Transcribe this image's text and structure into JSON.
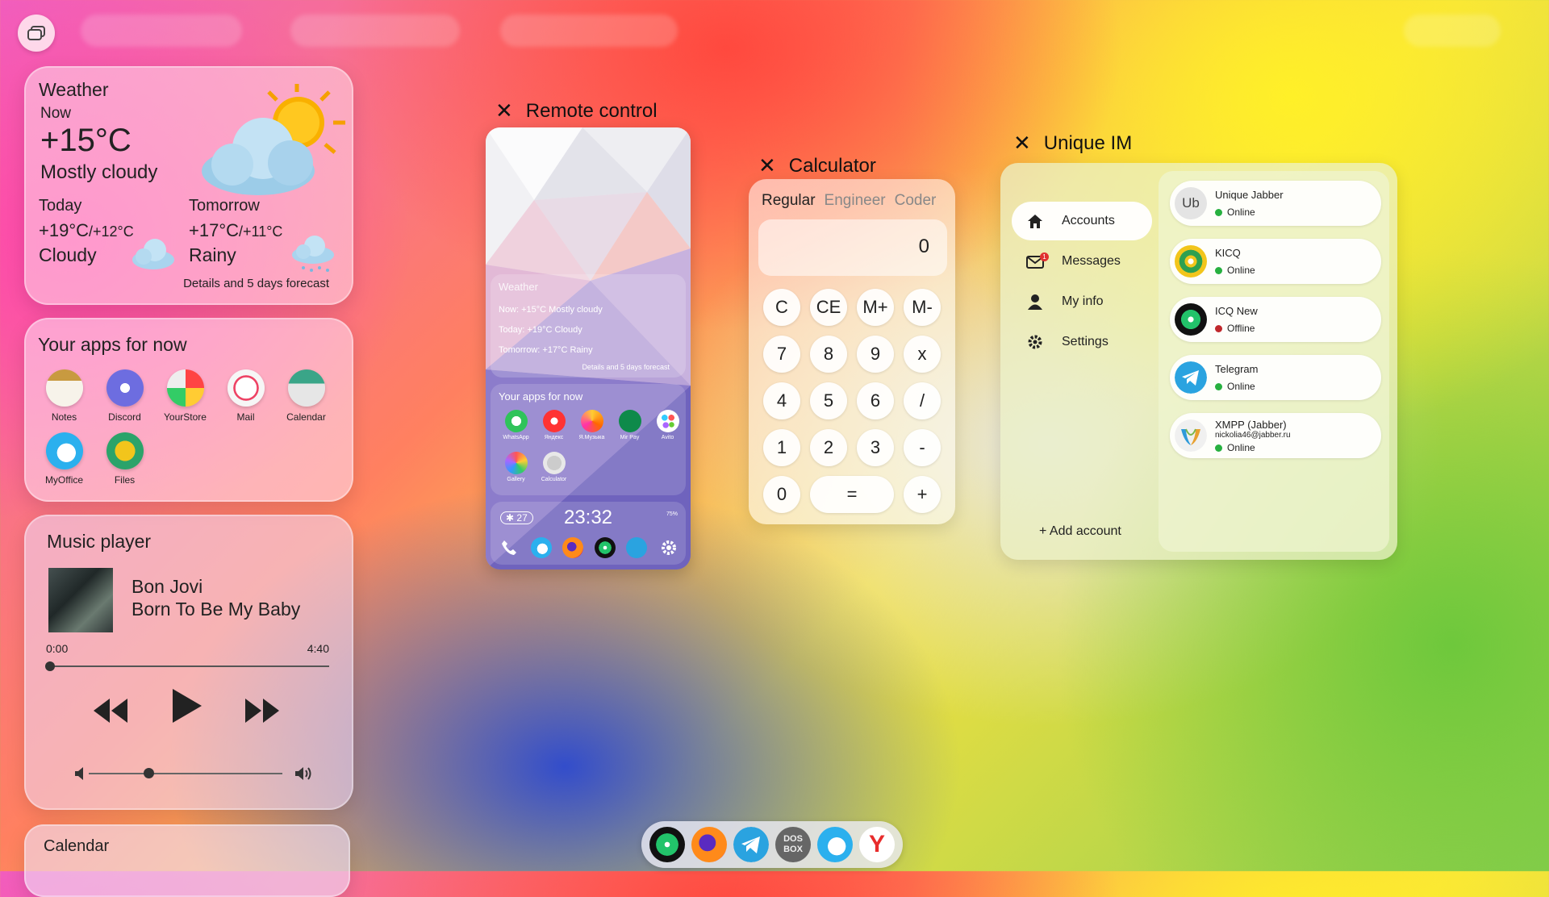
{
  "colors": {
    "online": "#27b040",
    "offline": "#c0282c",
    "accent_green": "#22c36a",
    "telegram": "#2aa3e0"
  },
  "weather": {
    "title": "Weather",
    "now_label": "Now",
    "temp": "+15°C",
    "condition": "Mostly cloudy",
    "today": {
      "label": "Today",
      "high": "+19°C",
      "low": "/+12°C",
      "condition": "Cloudy"
    },
    "tomorrow": {
      "label": "Tomorrow",
      "high": "+17°C",
      "low": "/+11°C",
      "condition": "Rainy"
    },
    "link": "Details and 5 days forecast"
  },
  "apps": {
    "title": "Your apps for now",
    "items": [
      {
        "label": "Notes",
        "icon": "notes-icon"
      },
      {
        "label": "Discord",
        "icon": "discord-icon"
      },
      {
        "label": "YourStore",
        "icon": "store-icon"
      },
      {
        "label": "Mail",
        "icon": "mail-icon"
      },
      {
        "label": "Calendar",
        "icon": "calendar-icon"
      },
      {
        "label": "MyOffice",
        "icon": "office-icon"
      },
      {
        "label": "Files",
        "icon": "files-icon"
      }
    ]
  },
  "music": {
    "title": "Music player",
    "artist": "Bon Jovi",
    "song": "Born To Be My Baby",
    "elapsed": "0:00",
    "duration": "4:40",
    "progress": 0.0,
    "volume": 0.3
  },
  "calendar": {
    "title": "Calendar"
  },
  "remote": {
    "title": "Remote control",
    "weather": {
      "title": "Weather",
      "now": "Now: +15°C Mostly cloudy",
      "today": "Today: +19°C Cloudy",
      "tomorrow": "Tomorrow: +17°C Rainy",
      "link": "Details and 5 days forecast"
    },
    "apps_title": "Your apps for now",
    "apps": [
      "WhatsApp",
      "Яндекс",
      "Я.Музыка",
      "Mir Pay",
      "Avito",
      "Gallery",
      "Calculator"
    ],
    "badge": "27",
    "clock": "23:32",
    "status": "75%"
  },
  "calculator": {
    "title": "Calculator",
    "tabs": [
      "Regular",
      "Engineer",
      "Coder"
    ],
    "display": "0",
    "keys": [
      "C",
      "CE",
      "M+",
      "M-",
      "7",
      "8",
      "9",
      "x",
      "4",
      "5",
      "6",
      "/",
      "1",
      "2",
      "3",
      "-",
      "0",
      "=",
      "+"
    ]
  },
  "im": {
    "title": "Unique IM",
    "nav": [
      "Accounts",
      "Messages",
      "My info",
      "Settings"
    ],
    "messages_badge": "1",
    "add": "+ Add account",
    "accounts": [
      {
        "name": "Unique Jabber",
        "sub": "",
        "status": "Online",
        "online": true,
        "icon": "unique-jabber-icon"
      },
      {
        "name": "KICQ",
        "sub": "",
        "status": "Online",
        "online": true,
        "icon": "kicq-icon"
      },
      {
        "name": "ICQ New",
        "sub": "",
        "status": "Offline",
        "online": false,
        "icon": "icq-icon"
      },
      {
        "name": "Telegram",
        "sub": "",
        "status": "Online",
        "online": true,
        "icon": "telegram-icon"
      },
      {
        "name": "XMPP (Jabber)",
        "sub": "nickolia46@jabber.ru",
        "status": "Online",
        "online": true,
        "icon": "xmpp-icon"
      }
    ],
    "avatar_text": "Ub"
  },
  "taskbar": {
    "items": [
      "icq-icon",
      "firefox-icon",
      "telegram-icon",
      "dosbox-icon",
      "cloud-icon",
      "yandex-browser-icon"
    ],
    "dosbox_text": "DOS BOX",
    "yandex_text": "Y"
  }
}
